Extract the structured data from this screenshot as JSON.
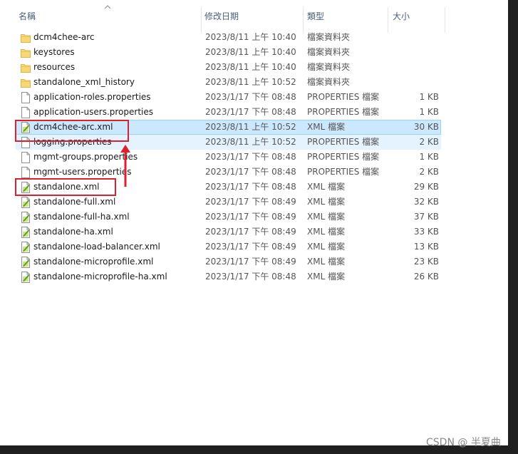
{
  "columns": {
    "name": "名稱",
    "date": "修改日期",
    "type": "類型",
    "size": "大小"
  },
  "files": [
    {
      "name": "dcm4chee-arc",
      "date": "2023/8/11 上午 10:40",
      "type": "檔案資料夾",
      "size": "",
      "icon": "folder-icon",
      "state": "normal"
    },
    {
      "name": "keystores",
      "date": "2023/8/11 上午 10:40",
      "type": "檔案資料夾",
      "size": "",
      "icon": "folder-icon",
      "state": "normal"
    },
    {
      "name": "resources",
      "date": "2023/8/11 上午 10:40",
      "type": "檔案資料夾",
      "size": "",
      "icon": "folder-icon",
      "state": "normal"
    },
    {
      "name": "standalone_xml_history",
      "date": "2023/8/11 上午 10:52",
      "type": "檔案資料夾",
      "size": "",
      "icon": "folder-icon",
      "state": "normal"
    },
    {
      "name": "application-roles.properties",
      "date": "2023/1/17 下午 08:48",
      "type": "PROPERTIES 檔案",
      "size": "1 KB",
      "icon": "file-icon",
      "state": "normal"
    },
    {
      "name": "application-users.properties",
      "date": "2023/1/17 下午 08:48",
      "type": "PROPERTIES 檔案",
      "size": "1 KB",
      "icon": "file-icon",
      "state": "normal"
    },
    {
      "name": "dcm4chee-arc.xml",
      "date": "2023/8/11 上午 10:52",
      "type": "XML 檔案",
      "size": "30 KB",
      "icon": "xml-file-icon",
      "state": "selected"
    },
    {
      "name": "logging.properties",
      "date": "2023/8/11 上午 10:52",
      "type": "PROPERTIES 檔案",
      "size": "2 KB",
      "icon": "file-icon",
      "state": "hovered"
    },
    {
      "name": "mgmt-groups.properties",
      "date": "2023/1/17 下午 08:48",
      "type": "PROPERTIES 檔案",
      "size": "1 KB",
      "icon": "file-icon",
      "state": "normal"
    },
    {
      "name": "mgmt-users.properties",
      "date": "2023/1/17 下午 08:48",
      "type": "PROPERTIES 檔案",
      "size": "2 KB",
      "icon": "file-icon",
      "state": "normal"
    },
    {
      "name": "standalone.xml",
      "date": "2023/1/17 下午 08:48",
      "type": "XML 檔案",
      "size": "29 KB",
      "icon": "xml-file-icon",
      "state": "normal"
    },
    {
      "name": "standalone-full.xml",
      "date": "2023/1/17 下午 08:49",
      "type": "XML 檔案",
      "size": "32 KB",
      "icon": "xml-file-icon",
      "state": "normal"
    },
    {
      "name": "standalone-full-ha.xml",
      "date": "2023/1/17 下午 08:49",
      "type": "XML 檔案",
      "size": "37 KB",
      "icon": "xml-file-icon",
      "state": "normal"
    },
    {
      "name": "standalone-ha.xml",
      "date": "2023/1/17 下午 08:49",
      "type": "XML 檔案",
      "size": "33 KB",
      "icon": "xml-file-icon",
      "state": "normal"
    },
    {
      "name": "standalone-load-balancer.xml",
      "date": "2023/1/17 下午 08:49",
      "type": "XML 檔案",
      "size": "13 KB",
      "icon": "xml-file-icon",
      "state": "normal"
    },
    {
      "name": "standalone-microprofile.xml",
      "date": "2023/1/17 下午 08:49",
      "type": "XML 檔案",
      "size": "23 KB",
      "icon": "xml-file-icon",
      "state": "normal"
    },
    {
      "name": "standalone-microprofile-ha.xml",
      "date": "2023/1/17 下午 08:48",
      "type": "XML 檔案",
      "size": "26 KB",
      "icon": "xml-file-icon",
      "state": "normal"
    }
  ],
  "watermark": "CSDN @ 半夏曲",
  "colors": {
    "annotation": "#d9212f",
    "selected_bg": "#cce8ff",
    "hover_bg": "#e5f3ff",
    "folder": "#f8d775"
  }
}
